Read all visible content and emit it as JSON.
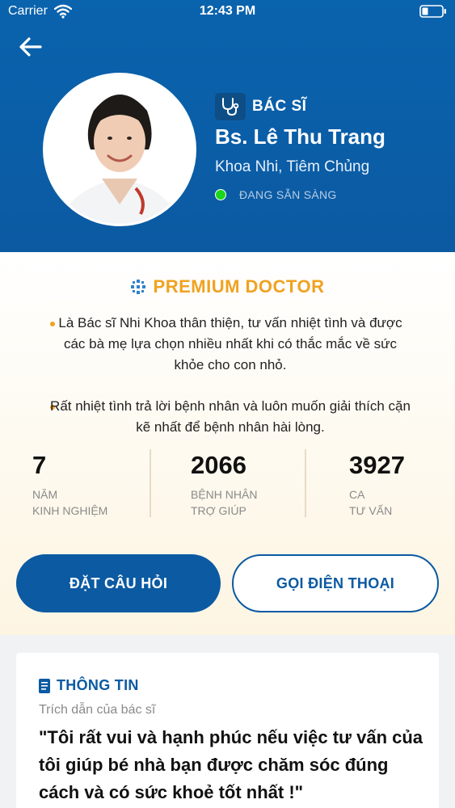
{
  "status_bar": {
    "carrier": "Carrier",
    "time": "12:43 PM"
  },
  "doctor": {
    "badge": "BÁC SĨ",
    "name": "Bs. Lê Thu Trang",
    "specialty": "Khoa Nhi, Tiêm Chủng",
    "status": "ĐANG SẴN SÀNG"
  },
  "premium": {
    "title": "PREMIUM DOCTOR",
    "bullets": [
      "Là Bác sĩ Nhi Khoa thân thiện, tư vấn nhiệt tình và được các bà mẹ lựa chọn nhiều nhất khi có thắc mắc về sức khỏe cho con nhỏ.",
      "Rất nhiệt tình trả lời bệnh nhân và luôn muốn giải thích cặn kẽ nhất để bệnh nhân hài lòng."
    ]
  },
  "stats": [
    {
      "value": "7",
      "label1": "NĂM",
      "label2": "KINH NGHIỆM"
    },
    {
      "value": "2066",
      "label1": "BỆNH NHÂN",
      "label2": "TRỢ GIÚP"
    },
    {
      "value": "3927",
      "label1": "CA",
      "label2": "TƯ VẤN"
    }
  ],
  "actions": {
    "ask": "ĐẶT CÂU HỎI",
    "call": "GỌI ĐIỆN THOẠI"
  },
  "info": {
    "title": "THÔNG TIN",
    "quote_label": "Trích dẫn của bác sĩ",
    "quote": "\"Tôi rất vui và hạnh phúc nếu việc tư vấn của tôi giúp bé nhà bạn được chăm sóc đúng cách và có sức khoẻ tốt nhất !\""
  },
  "colors": {
    "primary": "#0b5aa2",
    "premium": "#f0a221",
    "online": "#1bd61b"
  },
  "icons": [
    "wifi-icon",
    "battery-icon",
    "back-arrow-icon",
    "stethoscope-icon",
    "premium-icon",
    "document-icon"
  ]
}
